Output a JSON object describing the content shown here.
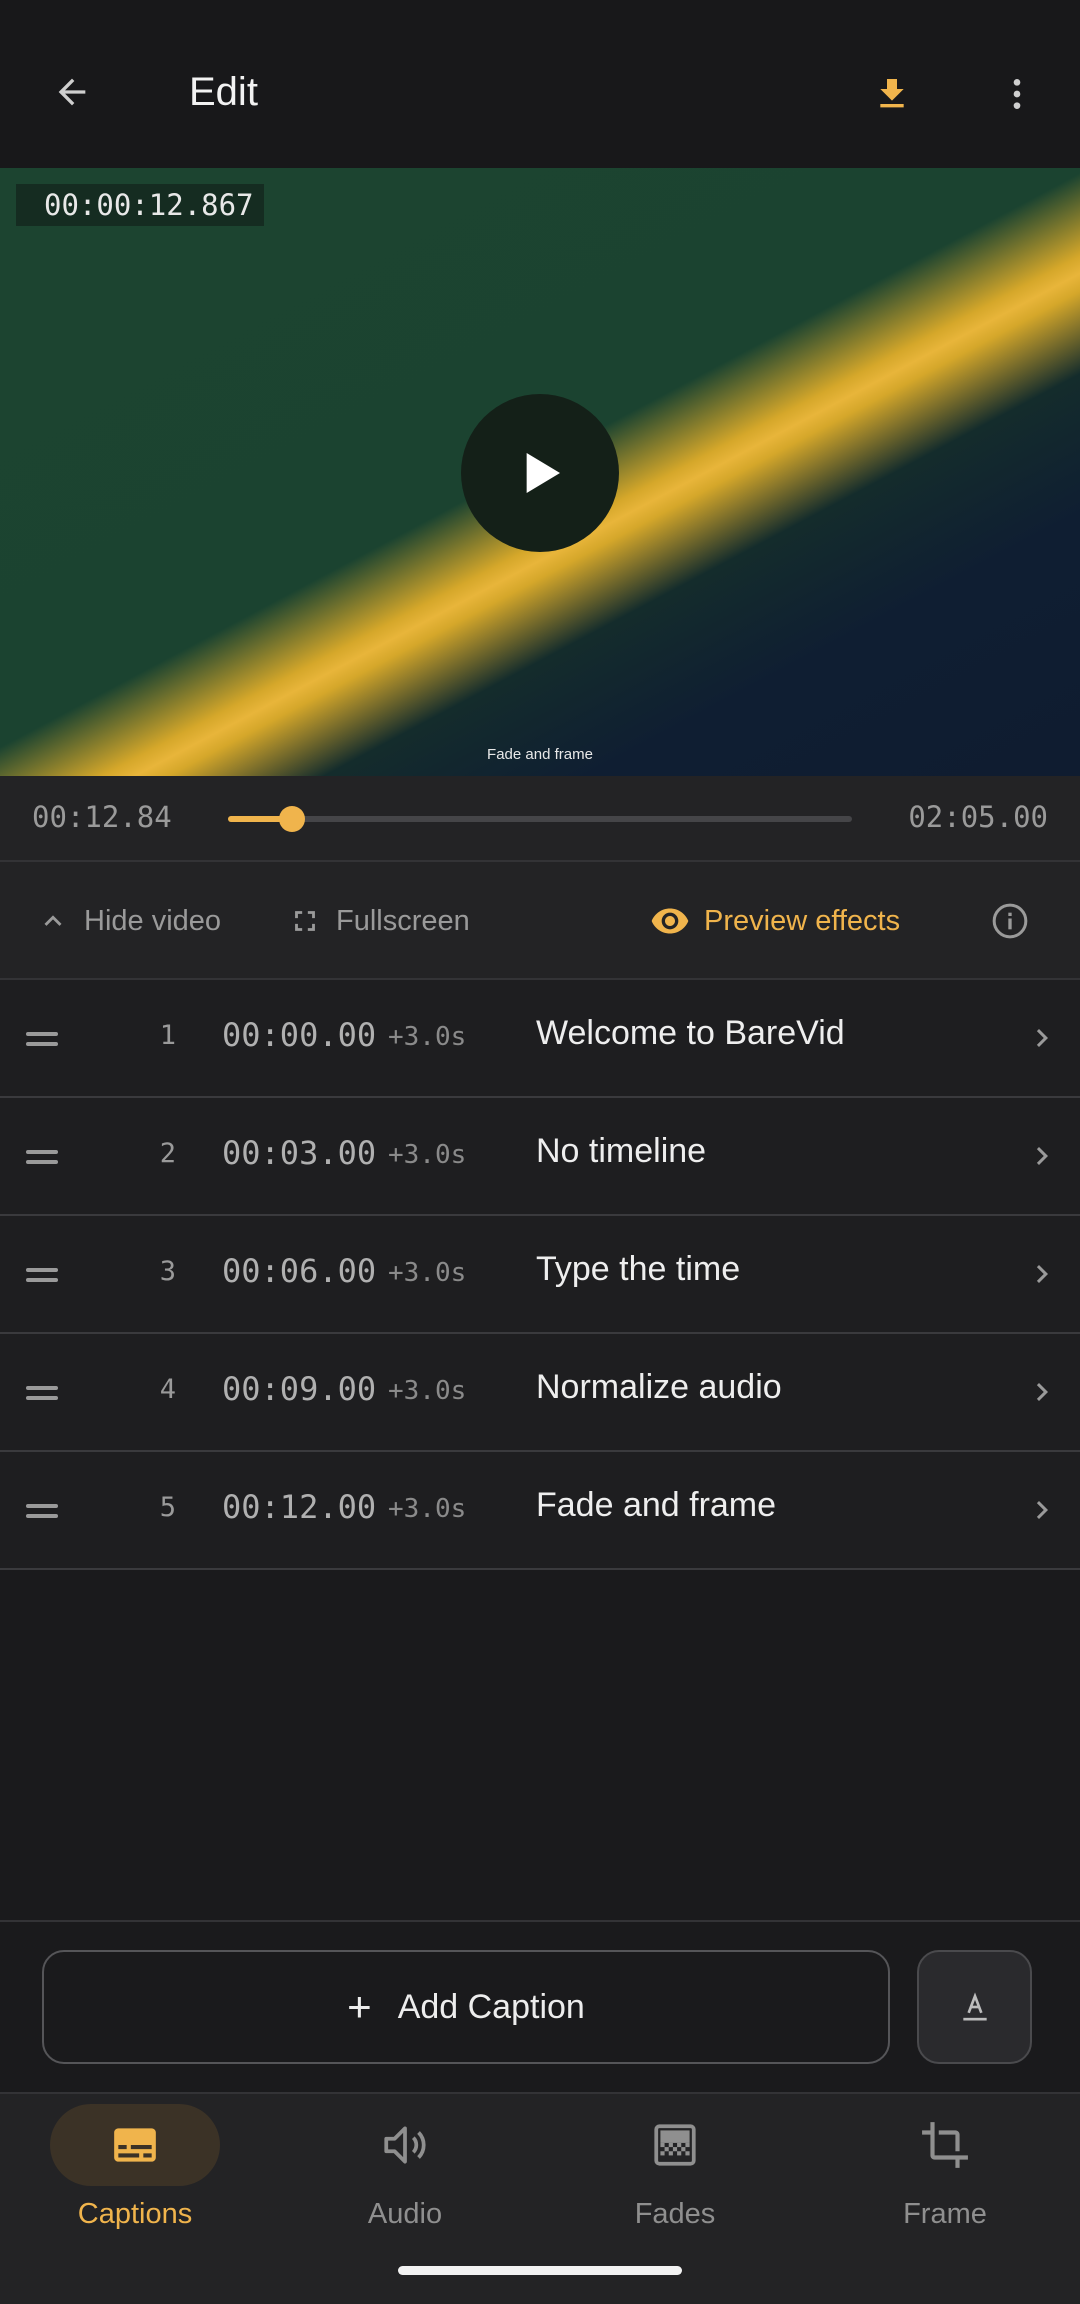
{
  "header": {
    "title": "Edit"
  },
  "player": {
    "timecode": "00:00:12.867",
    "caption_overlay": "Fade and frame",
    "current_time": "00:12.84",
    "total_time": "02:05.00",
    "progress_fraction": 0.103
  },
  "controls": {
    "hide_video": "Hide video",
    "fullscreen": "Fullscreen",
    "preview_effects": "Preview effects"
  },
  "captions": [
    {
      "index": "1",
      "start": "00:00.00",
      "duration": "+3.0s",
      "text": "Welcome to BareVid"
    },
    {
      "index": "2",
      "start": "00:03.00",
      "duration": "+3.0s",
      "text": "No timeline"
    },
    {
      "index": "3",
      "start": "00:06.00",
      "duration": "+3.0s",
      "text": "Type the time"
    },
    {
      "index": "4",
      "start": "00:09.00",
      "duration": "+3.0s",
      "text": "Normalize audio"
    },
    {
      "index": "5",
      "start": "00:12.00",
      "duration": "+3.0s",
      "text": "Fade and frame"
    }
  ],
  "actions": {
    "add_caption": "Add Caption"
  },
  "nav": {
    "tabs": [
      {
        "label": "Captions",
        "icon": "captions-icon",
        "active": true
      },
      {
        "label": "Audio",
        "icon": "speaker-icon",
        "active": false
      },
      {
        "label": "Fades",
        "icon": "fade-icon",
        "active": false
      },
      {
        "label": "Frame",
        "icon": "crop-icon",
        "active": false
      }
    ]
  },
  "colors": {
    "accent": "#f0b44c",
    "background": "#1a1a1c",
    "surface": "#232325"
  }
}
